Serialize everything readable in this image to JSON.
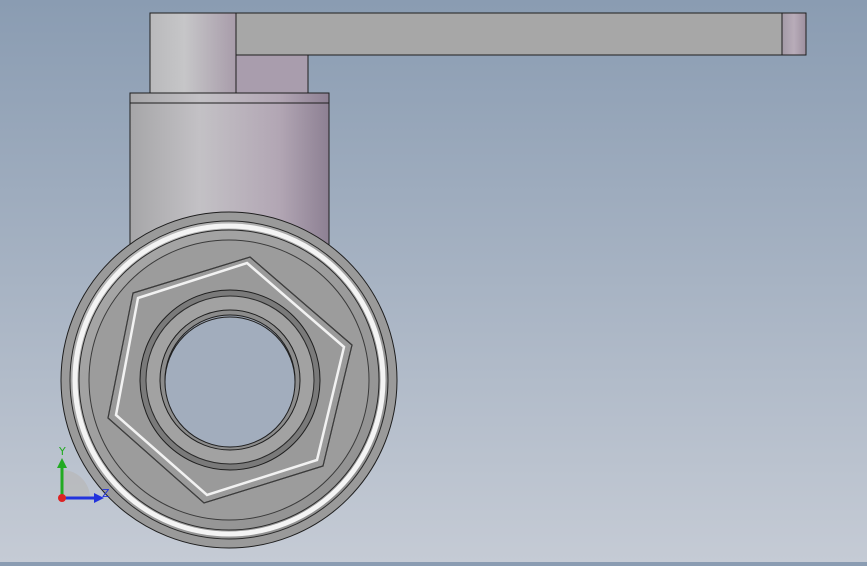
{
  "triad": {
    "y_label": "Y",
    "z_label": "Z",
    "colors": {
      "y": "#22aa22",
      "z": "#2233dd",
      "origin": "#dd2222"
    }
  }
}
